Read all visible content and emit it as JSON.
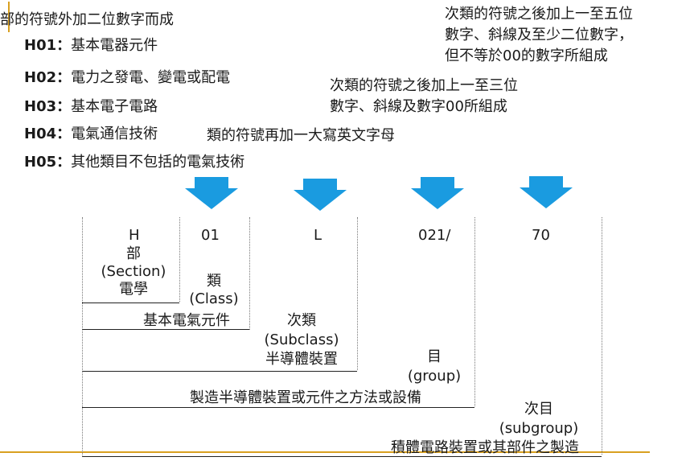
{
  "top_left_note": "部的符號外加二位數字而成",
  "sections": [
    {
      "code": "H01",
      "sep": "：",
      "desc": "基本電器元件"
    },
    {
      "code": "H02",
      "sep": "：",
      "desc": "電力之發電、變電或配電"
    },
    {
      "code": "H03",
      "sep": "：",
      "desc": "基本電子電路"
    },
    {
      "code": "H04",
      "sep": "：",
      "desc": "電氣通信技術"
    },
    {
      "code": "H05",
      "sep": "：",
      "desc": "其他類目不包括的電氣技術"
    }
  ],
  "subclass_note": "類的符號再加一大寫英文字母",
  "group_note_lines": [
    "次類的符號之後加上一至三位",
    "數字、斜線及數字00所組成"
  ],
  "subgroup_note_lines": [
    "次類的符號之後加上一至五位",
    "數字、斜線及至少二位數字，",
    "但不等於00的數字所組成"
  ],
  "code_parts": [
    "H",
    "01",
    "L",
    "021/",
    "70"
  ],
  "levels": {
    "section": {
      "name": "部",
      "english": "(Section)",
      "example": "電學"
    },
    "class": {
      "name": "類",
      "english": "(Class)",
      "example": "基本電氣元件"
    },
    "subclass": {
      "name": "次類",
      "english": "(Subclass)",
      "example": "半導體裝置"
    },
    "group": {
      "name": "目",
      "english": "(group)",
      "example": "製造半導體裝置或元件之方法或設備"
    },
    "subgroup": {
      "name": "次目",
      "english": "(subgroup)",
      "example": "積體電路裝置或其部件之製造"
    }
  },
  "colors": {
    "arrow": "#1a9be0",
    "accent_line": "#d9a020"
  }
}
